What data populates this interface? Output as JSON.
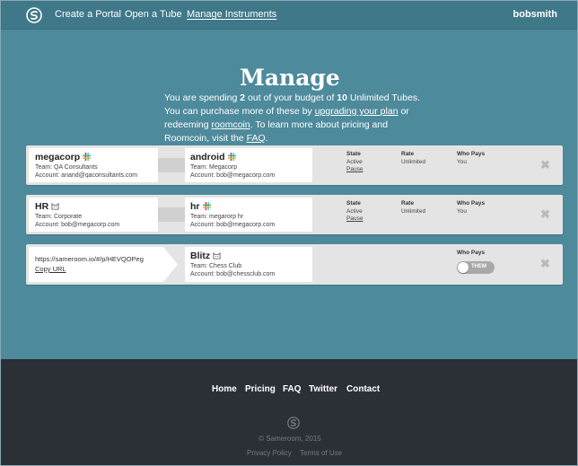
{
  "nav": {
    "links": [
      {
        "label": "Create a Portal"
      },
      {
        "label": "Open a Tube"
      },
      {
        "label": "Manage Instruments"
      }
    ],
    "user": "bobsmith"
  },
  "hero": {
    "title": "Manage",
    "line1_a": "You are spending ",
    "used": "2",
    "line1_b": " out of your budget of ",
    "budget": "10",
    "line1_c": " Unlimited Tubes. You can purchase more of these by ",
    "upgrade_link": "upgrading your plan",
    "line2_a": " or redeeming ",
    "roomcoin_link": "roomcoin",
    "line2_b": ". To learn more about pricing and Roomcoin, visit the ",
    "faq_link": "FAQ",
    "line2_c": "."
  },
  "labels": {
    "state": "State",
    "rate": "Rate",
    "who_pays": "Who Pays",
    "pause": "Pause",
    "close": "✖"
  },
  "tubes": [
    {
      "left": {
        "name": "megacorp",
        "team": "Team: QA Consultants",
        "account": "Account: anand@qaconsultants.com",
        "icon": "slack-icon"
      },
      "right": {
        "name": "android",
        "team": "Team: Megacorp",
        "account": "Account: bob@megacorp.com",
        "icon": "slack-icon"
      },
      "state": "Active",
      "rate": "Unlimited",
      "who_pays": "You"
    },
    {
      "left": {
        "name": "HR",
        "team": "Team: Corporate",
        "account": "Account: bob@megacorp.com",
        "icon": "cat-icon"
      },
      "right": {
        "name": "hr",
        "team": "Team: megarorp hr",
        "account": "Account: bob@megacorp.com",
        "icon": "slack-icon"
      },
      "state": "Active",
      "rate": "Unlimited",
      "who_pays": "You"
    }
  ],
  "portal": {
    "url": "https://sameroom.io/#/p/HEVQOPeg",
    "copy_label": "Copy URL",
    "right": {
      "name": "Blitz",
      "team": "Team: Chess Club",
      "account": "Account: bob@chessclub.com",
      "icon": "cat-icon"
    },
    "toggle_label": "THEM"
  },
  "footer": {
    "links": [
      {
        "label": "Home"
      },
      {
        "label": "Pricing"
      },
      {
        "label": "FAQ"
      },
      {
        "label": "Twitter"
      },
      {
        "label": "Contact"
      }
    ],
    "copyright": "© Sameroom, 2015",
    "privacy": "Privacy Policy",
    "terms": "Terms of Use"
  },
  "colors": {
    "accent": "#4d8a9b",
    "nav": "#3f7888",
    "footer": "#2b2f36"
  }
}
